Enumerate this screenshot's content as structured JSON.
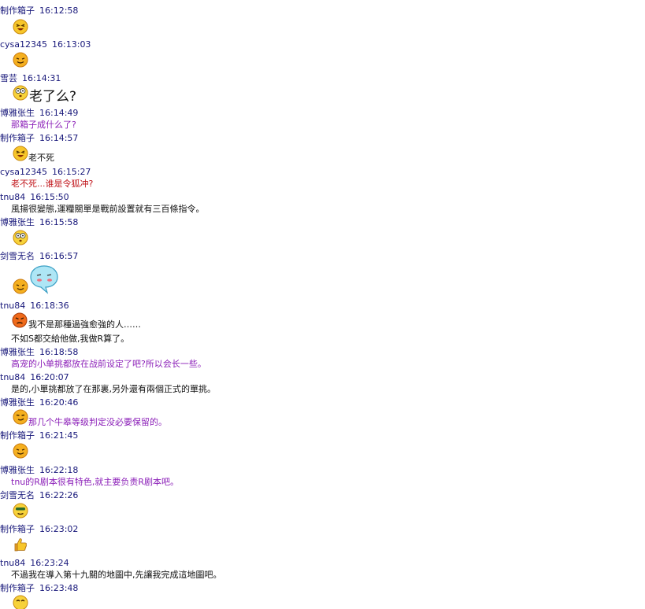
{
  "messages": [
    {
      "sender": "制作箱子",
      "time": "16:12:58",
      "emoji": "laughing-face-icon"
    },
    {
      "sender": "cysa12345",
      "time": "16:13:03",
      "emoji": "squint-smile-icon"
    },
    {
      "sender": "雪芸",
      "time": "16:14:31",
      "emoji": "wide-eyes-icon",
      "text": "老了么?"
    },
    {
      "sender": "博雅张生",
      "time": "16:14:49",
      "text": "那箱子成什么了?"
    },
    {
      "sender": "制作箱子",
      "time": "16:14:57",
      "emoji": "laughing-face-icon",
      "text": "老不死"
    },
    {
      "sender": "cysa12345",
      "time": "16:15:27",
      "text": "老不死...谁是令狐冲?"
    },
    {
      "sender": "tnu84",
      "time": "16:15:50",
      "text": "風揚很變態,運糧關單是戰前設置就有三百條指令。"
    },
    {
      "sender": "博雅张生",
      "time": "16:15:58",
      "emoji": "wide-eyes-icon"
    },
    {
      "sender": "剑雪无名",
      "time": "16:16:57",
      "emoji": "squint-smile-icon",
      "bubble": "blue-bubble-face-icon"
    },
    {
      "sender": "tnu84",
      "time": "16:18:36",
      "emoji": "angry-face-icon",
      "text": "我不是那種過強愈強的人……",
      "text2": "不如S都交給他做,我做R算了。"
    },
    {
      "sender": "博雅张生",
      "time": "16:18:58",
      "text": "高宠的小单挑都放在战前设定了吧?所以会长一些。"
    },
    {
      "sender": "tnu84",
      "time": "16:20:07",
      "text": "是的,小單挑都放了在那裏,另外還有兩個正式的單挑。"
    },
    {
      "sender": "博雅张生",
      "time": "16:20:46",
      "emoji": "smirk-face-icon",
      "text": "那几个牛皋等级判定没必要保留的。"
    },
    {
      "sender": "制作箱子",
      "time": "16:21:45",
      "emoji": "squint-smile-icon"
    },
    {
      "sender": "博雅张生",
      "time": "16:22:18",
      "text": "tnu的R剧本很有特色,就主要负责R剧本吧。"
    },
    {
      "sender": "剑雪无名",
      "time": "16:22:26",
      "emoji": "cool-face-icon"
    },
    {
      "sender": "制作箱子",
      "time": "16:23:02",
      "emoji": "thumbs-up-icon"
    },
    {
      "sender": "tnu84",
      "time": "16:23:24",
      "text": "不過我在導入第十九關的地圖中,先讓我完成這地圖吧。"
    },
    {
      "sender": "制作箱子",
      "time": "16:23:48",
      "emoji": "happy-face-icon"
    }
  ],
  "colors": {
    "header": "#17177a",
    "black_text": "#111111",
    "purple_text": "#8b1fb8",
    "red_text": "#c0141a",
    "emoji_yellow": "#f7c62a",
    "emoji_orange": "#ef8a1a",
    "bubble_blue": "#aee6f5"
  }
}
